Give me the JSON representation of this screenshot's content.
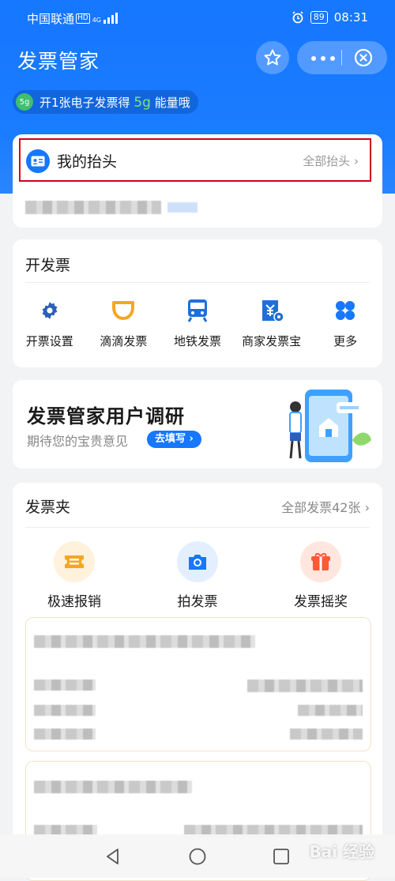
{
  "status_bar": {
    "carrier": "中国联通",
    "hd": "HD",
    "network": "4G",
    "battery": "89",
    "time": "08:31"
  },
  "app": {
    "title": "发票管家",
    "energy_prefix": "开1张电子发票得",
    "energy_amount": "5g",
    "energy_suffix": "能量哦",
    "energy_badge": "5g"
  },
  "my_header": {
    "label": "我的抬头",
    "all_link": "全部抬头"
  },
  "issue": {
    "title": "开发票",
    "items": [
      {
        "label": "开票设置",
        "icon": "gear-icon"
      },
      {
        "label": "滴滴发票",
        "icon": "didi-icon"
      },
      {
        "label": "地铁发票",
        "icon": "subway-icon"
      },
      {
        "label": "商家发票宝",
        "icon": "merchant-invoice-icon"
      },
      {
        "label": "更多",
        "icon": "grid-more-icon"
      }
    ]
  },
  "survey": {
    "title": "发票管家用户调研",
    "subtitle": "期待您的宝贵意见",
    "button": "去填写"
  },
  "folder": {
    "title": "发票夹",
    "all_link": "全部发票42张",
    "items": [
      {
        "label": "极速报销",
        "icon": "ticket-icon",
        "color": "#f5a623"
      },
      {
        "label": "拍发票",
        "icon": "camera-icon",
        "color": "#1677ff"
      },
      {
        "label": "发票摇奖",
        "icon": "gift-icon",
        "color": "#ff5a36"
      }
    ]
  },
  "colors": {
    "primary": "#1677ff",
    "highlight_border": "#d0021b"
  },
  "watermark": "Bai 经验"
}
